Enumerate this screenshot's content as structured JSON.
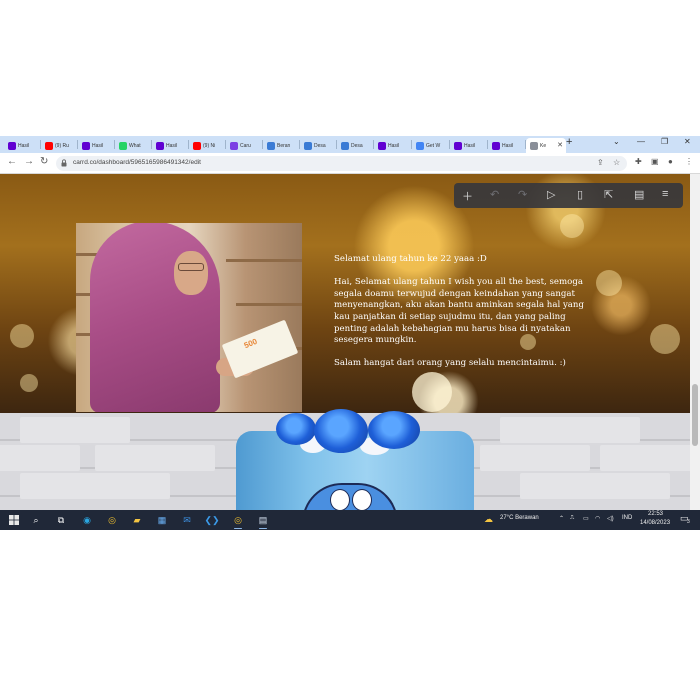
{
  "browser": {
    "tabs": [
      {
        "label": "Hasil",
        "favicon": "yahoo-icon",
        "color": "#6001d2"
      },
      {
        "label": "(9) Ru",
        "favicon": "youtube-icon",
        "color": "#ff0000"
      },
      {
        "label": "Hasil",
        "favicon": "yahoo-icon",
        "color": "#6001d2"
      },
      {
        "label": "What",
        "favicon": "whatsapp-icon",
        "color": "#25d366"
      },
      {
        "label": "Hasil",
        "favicon": "yahoo-icon",
        "color": "#6001d2"
      },
      {
        "label": "(9) Ni",
        "favicon": "youtube-icon",
        "color": "#ff0000"
      },
      {
        "label": "Caru",
        "favicon": "b-icon",
        "color": "#7b3fe4"
      },
      {
        "label": "Beran",
        "favicon": "globe-icon",
        "color": "#3a7bd5"
      },
      {
        "label": "Desa",
        "favicon": "globe-icon",
        "color": "#3a7bd5"
      },
      {
        "label": "Desa",
        "favicon": "globe-icon",
        "color": "#3a7bd5"
      },
      {
        "label": "Hasil",
        "favicon": "yahoo-icon",
        "color": "#6001d2"
      },
      {
        "label": "Get W",
        "favicon": "google-icon",
        "color": "#4285f4"
      },
      {
        "label": "Hasil",
        "favicon": "yahoo-icon",
        "color": "#6001d2"
      },
      {
        "label": "Hasil",
        "favicon": "yahoo-icon",
        "color": "#6001d2"
      },
      {
        "label": "Ke",
        "favicon": "carrd-icon",
        "color": "#8a8f99",
        "active": true
      }
    ],
    "new_tab_label": "+",
    "url": "carrd.co/dashboard/5965165986491342/edit"
  },
  "message": {
    "heading": "Selamat ulang tahun ke 22 yaaa :D",
    "body": "Hai, Selamat ulang tahun I wish you all the best, semoga segala doamu terwujud dengan keindahan yang sangat menyenangkan, aku akan bantu aminkan segala hal yang kau panjatkan di setiap sujudmu itu, dan yang paling penting adalah kebahagian mu harus bisa di nyatakan sesegera mungkin.",
    "closing": "Salam hangat dari orang yang selalu mencintaimu. :)"
  },
  "photo": {
    "book_label": "500"
  },
  "editor_toolbar": {
    "tools": [
      "add-icon",
      "undo-icon",
      "redo-icon",
      "play-icon",
      "mobile-preview-icon",
      "publish-icon",
      "save-icon",
      "menu-icon"
    ]
  },
  "taskbar": {
    "weather": "27°C  Berawan",
    "language": "IND",
    "time": "22:53",
    "date": "14/08/2023",
    "notification_count": "3"
  }
}
